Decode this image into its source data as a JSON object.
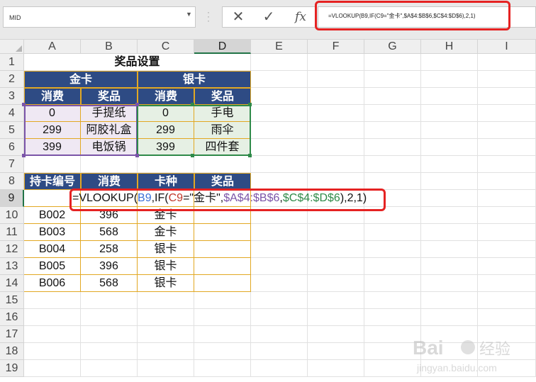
{
  "name_box": "MID",
  "formula_bar": {
    "cancel_icon": "✕",
    "enter_icon": "✓",
    "fx_label": "fx",
    "text": "=VLOOKUP(B9,IF(C9=\"金卡\",$A$4:$B$6,$C$4:$D$6),2,1)"
  },
  "columns": [
    "A",
    "B",
    "C",
    "D",
    "E",
    "F",
    "G",
    "H",
    "I"
  ],
  "rows": [
    "1",
    "2",
    "3",
    "4",
    "5",
    "6",
    "7",
    "8",
    "9",
    "10",
    "11",
    "12",
    "13",
    "14",
    "15",
    "16",
    "17",
    "18",
    "19"
  ],
  "prize_table": {
    "title": "奖品设置",
    "gold_card": "金卡",
    "silver_card": "银卡",
    "spend": "消费",
    "prize": "奖品",
    "gold_rows": [
      [
        "0",
        "手提纸"
      ],
      [
        "299",
        "阿胶礼盒"
      ],
      [
        "399",
        "电饭锅"
      ]
    ],
    "silver_rows": [
      [
        "0",
        "手电"
      ],
      [
        "299",
        "雨伞"
      ],
      [
        "399",
        "四件套"
      ]
    ]
  },
  "card_table": {
    "headers": [
      "持卡编号",
      "消费",
      "卡种",
      "奖品"
    ],
    "rows": [
      [
        "B002",
        "396",
        "金卡",
        ""
      ],
      [
        "B003",
        "568",
        "金卡",
        ""
      ],
      [
        "B004",
        "258",
        "银卡",
        ""
      ],
      [
        "B005",
        "396",
        "银卡",
        ""
      ],
      [
        "B006",
        "568",
        "银卡",
        ""
      ]
    ]
  },
  "editing_formula": {
    "p1": "=VLOOKUP(",
    "p2": "B9",
    "p3": ",IF(",
    "p4": "C9",
    "p5": "=\"金卡\",",
    "p6": "$A$4:$B$6",
    "p7": ",",
    "p8": "$C$4:$D$6",
    "p9": "),2,1)"
  },
  "colors": {
    "header_blue": "#2e4b84",
    "gold_border": "#e2a823",
    "highlight_red": "#e52222",
    "ref_purple": "#7a54a8",
    "ref_green": "#2f8a49",
    "ref_blue": "#3a6fd6",
    "ref_red": "#c0392b"
  },
  "watermark": {
    "brand": "Bai",
    "brand2": "经验",
    "url": "jingyan.baidu.com"
  }
}
